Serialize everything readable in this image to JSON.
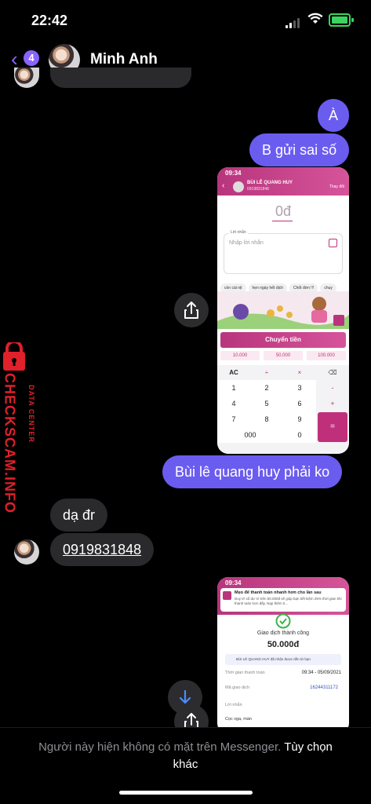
{
  "status": {
    "time": "22:42"
  },
  "header": {
    "unread_count": "4",
    "contact_name": "Minh Anh"
  },
  "messages": {
    "m1": "À",
    "m2": "B gửi sai số",
    "m3": "Bùi lê quang huy phải ko",
    "m4": "dạ đr",
    "m5": "0919831848"
  },
  "transfer_screenshot": {
    "time": "09:34",
    "recipient_name": "BÙI LÊ QUANG HUY",
    "recipient_phone": "0919831848",
    "change_label": "Thay đổi",
    "amount": "0đ",
    "message_label": "Lời nhắn",
    "message_placeholder": "Nhập lời nhắn",
    "chips": [
      "còn cái nịt",
      "hẹn ngày hết dịch",
      "Chốt đơn !!!",
      "chuy"
    ],
    "transfer_button": "Chuyển tiền",
    "quick_amounts": [
      "10.000",
      "50.000",
      "100.000"
    ],
    "keys": [
      "AC",
      "÷",
      "×",
      "⌫",
      "1",
      "2",
      "3",
      "-",
      "4",
      "5",
      "6",
      "+",
      "7",
      "8",
      "9",
      "=",
      "000",
      "0"
    ]
  },
  "receipt_screenshot": {
    "time": "09:34",
    "tip_title": "Mẹo để thanh toán nhanh hơn cho lần sau",
    "tip_body": "Duy trì số dư Ví trên 50.000đ sẽ giúp bạn tiết kiệm 25% thời gian khi thanh toán hơn đấy. Nạp thêm ti...",
    "success_label": "Giao dịch thành công",
    "amount": "50.000đ",
    "notice": "BÙI LÊ QUANG HUY đã nhận được tiền từ bạn",
    "time_label": "Thời gian thanh toán",
    "time_value": "09:34 - 05/09/2021",
    "txn_label": "Mã giao dịch",
    "txn_value": "16244311172",
    "msg_label": "Lời nhắn",
    "msg_value": "Cọc vga, màn"
  },
  "watermark": {
    "brand": "CHECKSCAM.INFO",
    "sub": "DATA CENTER"
  },
  "footer": {
    "text": "Người này hiện không có mặt trên Messenger.",
    "action": "Tùy chọn khác"
  },
  "colors": {
    "outgoing": "#6b5cf0",
    "incoming": "#2a2a2c",
    "accent": "#8a63ff",
    "momo_pink": "#c0307a",
    "watermark_red": "#e0202a"
  }
}
